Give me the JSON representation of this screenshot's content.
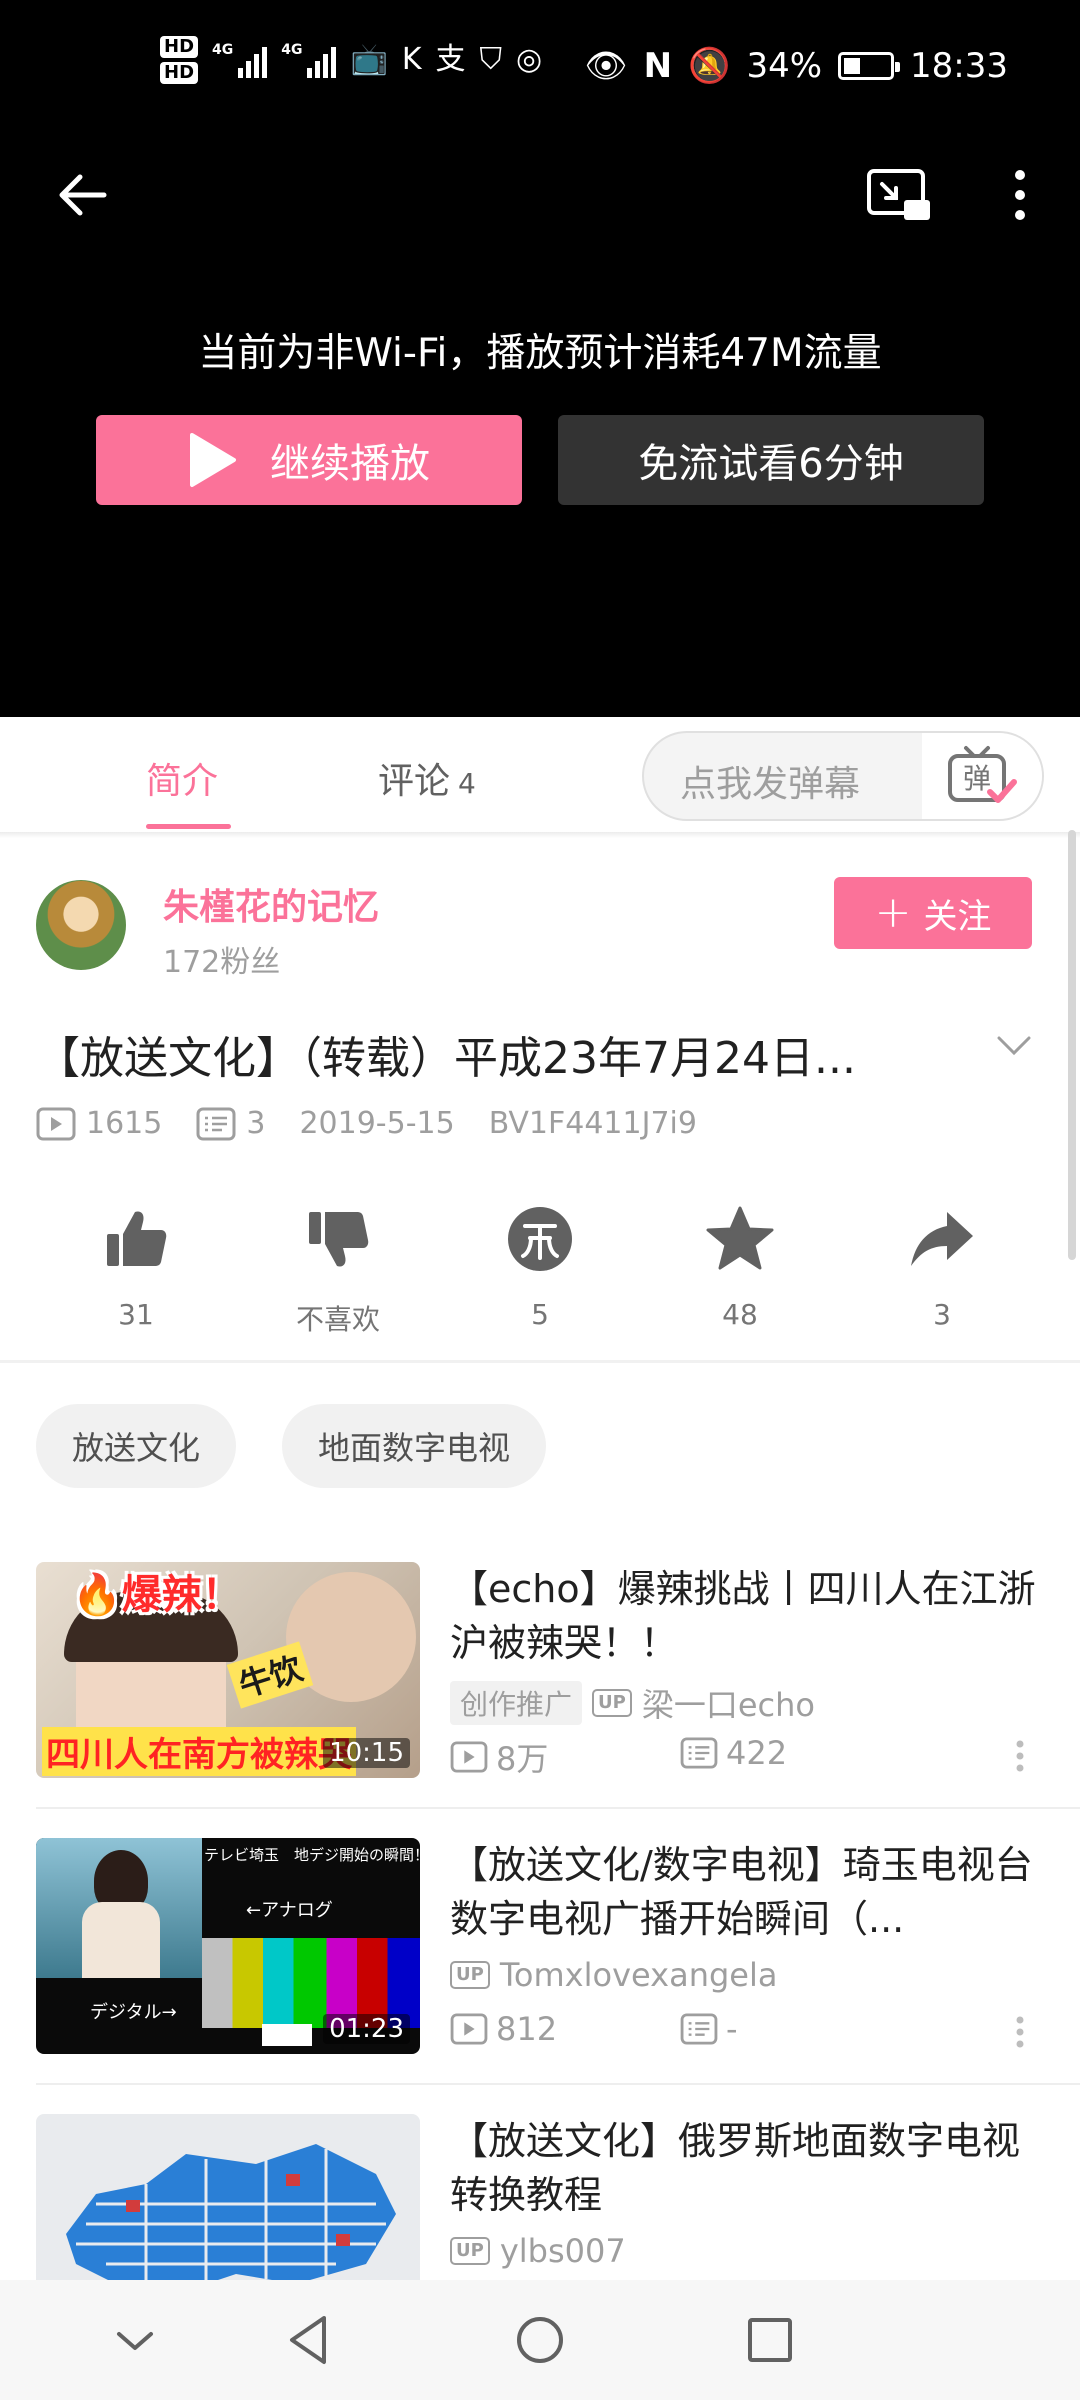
{
  "status_bar": {
    "hd1": "HD",
    "hd2": "HD",
    "net1": "4G",
    "net2": "4G",
    "battery": "34%",
    "time": "18:33"
  },
  "player": {
    "traffic_notice": "当前为非Wi-Fi，播放预计消耗47M流量",
    "continue_label": "继续播放",
    "free_label": "免流试看6分钟"
  },
  "tabs": {
    "intro": "简介",
    "comments": "评论",
    "comment_count": "4",
    "danmaku_placeholder": "点我发弹幕",
    "danmaku_icon_text": "弹"
  },
  "uploader": {
    "name": "朱槿花的记忆",
    "fans": "172粉丝",
    "follow_label": "关注"
  },
  "video": {
    "title": "【放送文化】（转载）平成23年7月24日...",
    "views": "1615",
    "danmaku": "3",
    "date": "2019-5-15",
    "bvid": "BV1F4411J7i9"
  },
  "actions": {
    "like": "31",
    "dislike": "不喜欢",
    "coin": "5",
    "favorite": "48",
    "share": "3"
  },
  "tags": [
    "放送文化",
    "地面数字电视"
  ],
  "recommendations": [
    {
      "title": "【echo】爆辣挑战丨四川人在江浙沪被辣哭！！",
      "promo": "创作推广",
      "up_badge": "UP",
      "uploader": "梁一口echo",
      "views": "8万",
      "danmaku": "422",
      "duration": "10:15",
      "thumb_text_top": "🔥爆辣！",
      "thumb_text_side": "牛饮",
      "thumb_text_bottom": "四川人在南方被辣哭"
    },
    {
      "title": "【放送文化/数字电视】琦玉电视台 数字电视广播开始瞬间（...",
      "up_badge": "UP",
      "uploader": "Tomxlovexangela",
      "views": "812",
      "danmaku": "-",
      "duration": "01:23",
      "thumb_text_top": "テレビ埼玉　地デジ開始の瞬間！",
      "thumb_text_analog": "←アナログ",
      "thumb_text_digital": "デジタル→"
    },
    {
      "title": "【放送文化】俄罗斯地面数字电视转换教程",
      "up_badge": "UP",
      "uploader": "ylbs007"
    }
  ],
  "colors": {
    "brand_pink": "#fb7299",
    "dark_button": "#333333",
    "muted_text": "#9e9e9e"
  },
  "icons": [
    "back-arrow-icon",
    "cast-icon",
    "more-vertical-icon",
    "play-icon",
    "danmaku-toggle-icon",
    "plus-icon",
    "chevron-down-icon",
    "views-icon",
    "danmaku-count-icon",
    "thumb-up-icon",
    "thumb-down-icon",
    "coin-icon",
    "star-icon",
    "share-icon"
  ]
}
